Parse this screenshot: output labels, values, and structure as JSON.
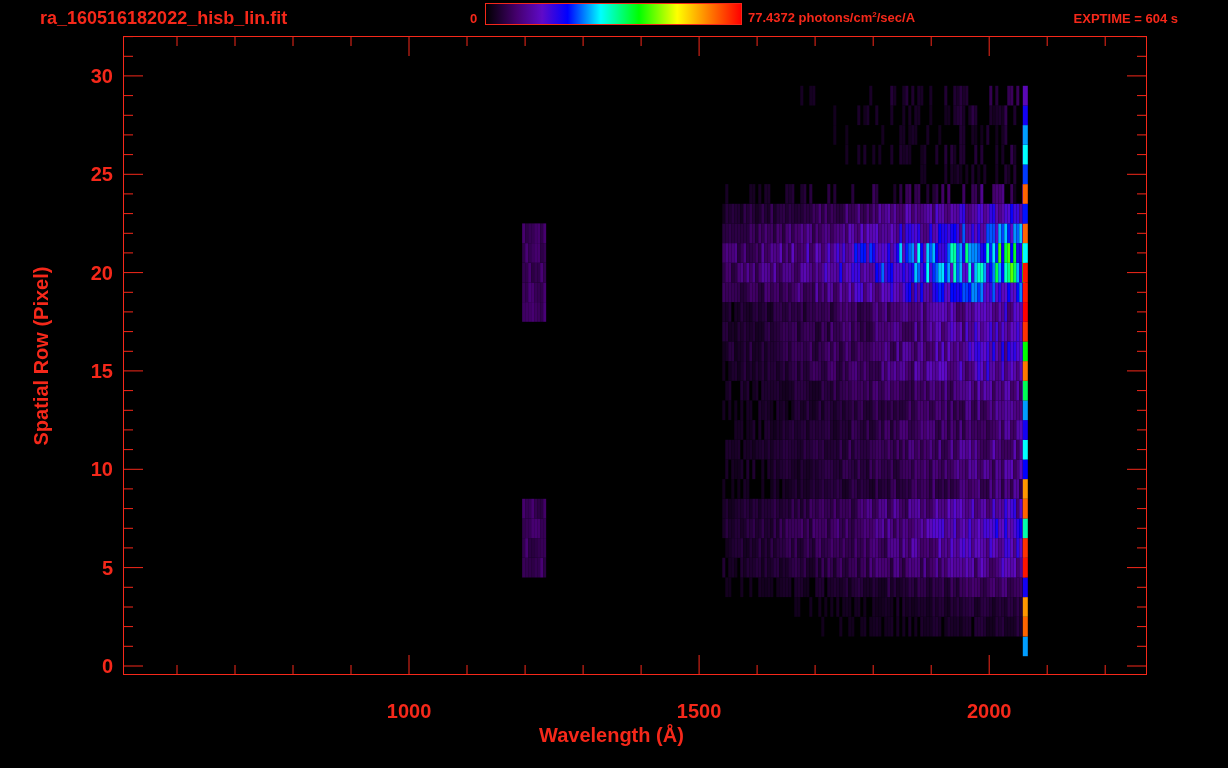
{
  "header": {
    "filename": "ra_160516182022_hisb_lin.fit",
    "colorbar": {
      "min_label": "0",
      "max_label": "77.4372 photons/cm$^{2}$/sec/A"
    },
    "exposure": "EXPTIME = 604 s"
  },
  "plot": {
    "y_axis": {
      "label": "Spatial Row (Pixel)",
      "ticks": [
        "30",
        "25",
        "20",
        "15",
        "10",
        "5",
        "0"
      ]
    },
    "x_axis": {
      "label": "Wavelength (Å)",
      "ticks": [
        "1000",
        "1500",
        "2000"
      ]
    }
  }
}
